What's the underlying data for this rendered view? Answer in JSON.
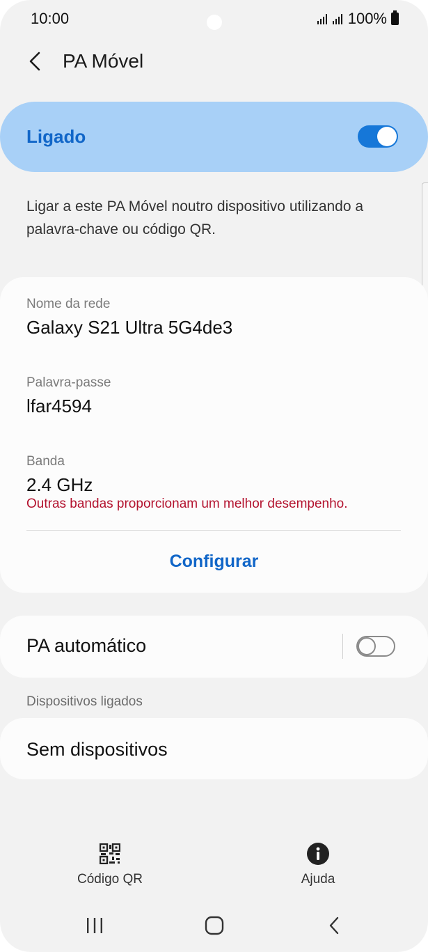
{
  "status_bar": {
    "time": "10:00",
    "battery": "100%"
  },
  "header": {
    "title": "PA Móvel"
  },
  "master_switch": {
    "label": "Ligado",
    "state": "on",
    "banner_color": "#a8d0f7",
    "accent_color": "#1166c8"
  },
  "description": "Ligar a este PA Móvel noutro dispositivo utilizando a palavra-chave ou código QR.",
  "network_info": {
    "name_label": "Nome da rede",
    "name_value": "Galaxy S21 Ultra 5G4de3",
    "password_label": "Palavra-passe",
    "password_value": "lfar4594",
    "band_label": "Banda",
    "band_value": "2.4 GHz",
    "band_warning": "Outras bandas proporcionam um melhor desempenho.",
    "configure_label": "Configurar"
  },
  "auto_hotspot": {
    "label": "PA automático",
    "state": "off"
  },
  "connected_devices": {
    "section_title": "Dispositivos ligados",
    "empty_label": "Sem dispositivos"
  },
  "bottom_actions": [
    {
      "label": "Código QR",
      "icon": "qr-code-icon"
    },
    {
      "label": "Ajuda",
      "icon": "info-icon"
    }
  ],
  "nav_bar": {
    "icons": [
      "recent-apps-icon",
      "home-icon",
      "back-icon"
    ]
  },
  "colors": {
    "warning": "#b3122e",
    "background": "#f2f2f2"
  }
}
